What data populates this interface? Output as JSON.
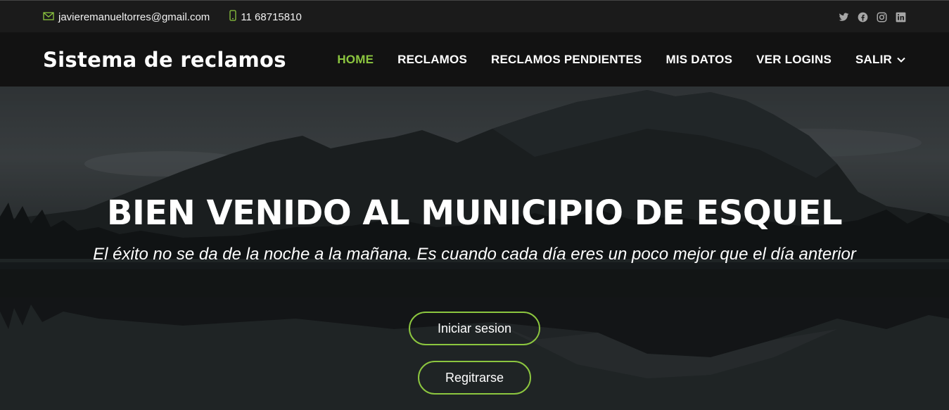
{
  "topbar": {
    "email": "javieremanueltorres@gmail.com",
    "phone": "11 68715810",
    "social": [
      "twitter-icon",
      "facebook-icon",
      "instagram-icon",
      "linkedin-icon"
    ]
  },
  "navbar": {
    "brand": "Sistema de reclamos",
    "items": [
      {
        "label": "HOME",
        "active": true
      },
      {
        "label": "RECLAMOS"
      },
      {
        "label": "RECLAMOS PENDIENTES"
      },
      {
        "label": "MIS DATOS"
      },
      {
        "label": "VER LOGINS"
      },
      {
        "label": "SALIR"
      }
    ]
  },
  "hero": {
    "title": "BIEN VENIDO AL MUNICIPIO DE ESQUEL",
    "subtitle": "El éxito no se da de la noche a la mañana. Es cuando cada día eres un poco mejor que el día anterior",
    "login_button": "Iniciar sesion",
    "register_button": "Regitrarse"
  },
  "colors": {
    "accent": "#8cc63f",
    "topbar_bg": "#1b1b1b",
    "navbar_bg": "#121212"
  }
}
